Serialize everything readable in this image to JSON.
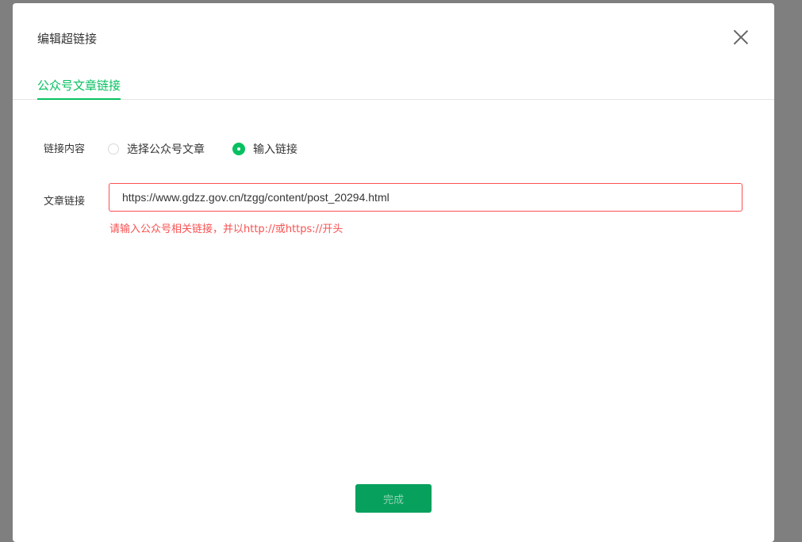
{
  "dialog": {
    "title": "编辑超链接",
    "close_icon": "close-icon"
  },
  "tabs": [
    {
      "label": "公众号文章链接",
      "active": true
    }
  ],
  "form": {
    "content_label": "链接内容",
    "radio_options": [
      {
        "label": "选择公众号文章",
        "checked": false
      },
      {
        "label": "输入链接",
        "checked": true
      }
    ],
    "link_label": "文章链接",
    "link_value": "https://www.gdzz.gov.cn/tzgg/content/post_20294.html",
    "error_text": "请输入公众号相关链接，并以http://或https://开头"
  },
  "footer": {
    "done_label": "完成"
  },
  "colors": {
    "accent": "#07c160",
    "error": "#fa5151",
    "overlay": "#7f7f7f"
  }
}
